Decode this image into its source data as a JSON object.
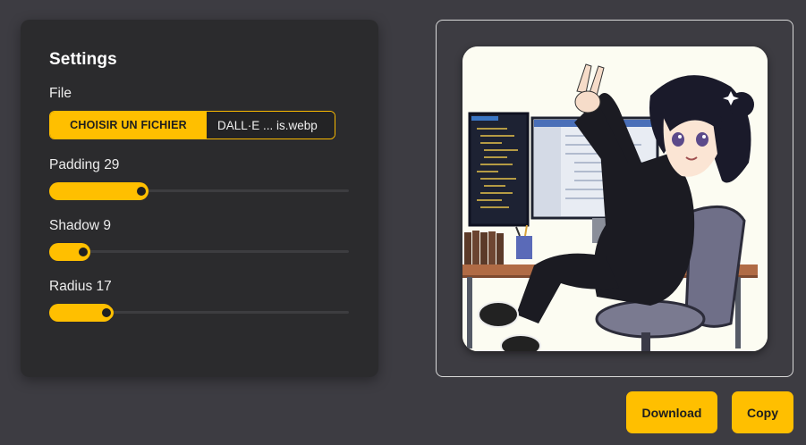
{
  "settings": {
    "title": "Settings",
    "file_label": "File",
    "file_button_label": "CHOISIR UN FICHIER",
    "file_name": "DALL·E ... is.webp",
    "padding_label": "Padding 29",
    "padding_value": 29,
    "shadow_label": "Shadow 9",
    "shadow_value": 9,
    "radius_label": "Radius 17",
    "radius_value": 17
  },
  "preview": {
    "image_description_icon": "anime-girl-desk-image"
  },
  "actions": {
    "download_label": "Download",
    "copy_label": "Copy"
  },
  "colors": {
    "accent": "#ffbf00",
    "panel": "#2b2b2d",
    "background": "#3d3c42"
  }
}
